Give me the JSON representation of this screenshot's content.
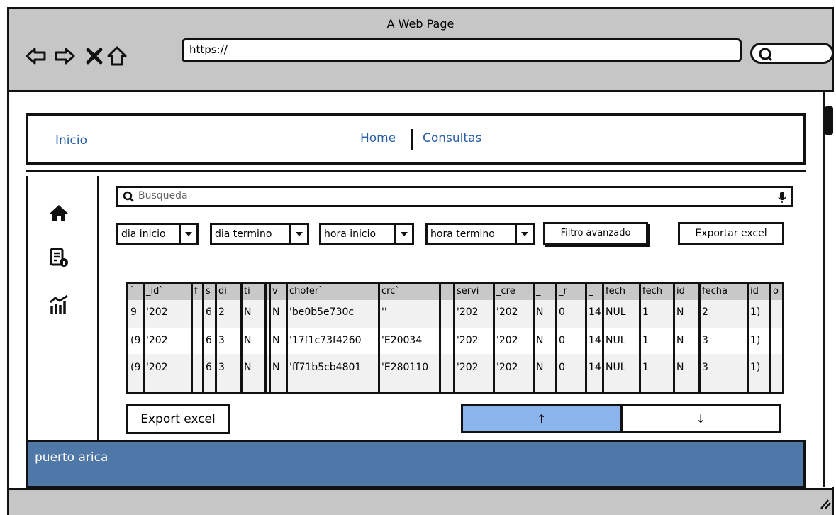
{
  "window": {
    "title": "A Web Page",
    "url": "https://"
  },
  "nav": {
    "left_link": "Inicio",
    "center_links": [
      "Home",
      "Consultas"
    ]
  },
  "search": {
    "placeholder": "Busqueda"
  },
  "filters": {
    "dropdowns": [
      "dia inicio",
      "dia termino",
      "hora inicio",
      "hora termino"
    ],
    "advanced_filter": "Filtro avanzado",
    "export_excel": "Exportar excel"
  },
  "table": {
    "headers": [
      "`",
      "_id`",
      "f",
      "s",
      "di",
      "ti",
      "",
      "v",
      "chofer`",
      "crc`",
      "",
      "servi",
      "_cre",
      "_",
      "_r",
      "_",
      "fech",
      "fech",
      "id",
      "fecha",
      "id",
      "o"
    ],
    "rows": [
      [
        "9",
        "'202",
        "",
        "6",
        "2",
        "N",
        "",
        "N",
        "'be0b5e730c",
        "''",
        "",
        "'202",
        "'202",
        "N",
        "0",
        "14",
        "NUL",
        "1",
        "N",
        "2",
        "1)",
        ""
      ],
      [
        "(9",
        "'202",
        "",
        "6",
        "3",
        "N",
        "",
        "N",
        "'17f1c73f4260",
        "'E20034",
        "",
        "'202",
        "'202",
        "N",
        "0",
        "14",
        "NUL",
        "1",
        "N",
        "3",
        "1)",
        ""
      ],
      [
        "(9",
        "'202",
        "",
        "6",
        "3",
        "N",
        "",
        "N",
        "'ff71b5cb4801",
        "'E280110",
        "",
        "'202",
        "'202",
        "N",
        "0",
        "14",
        "NUL",
        "1",
        "N",
        "3",
        "1)",
        ""
      ]
    ]
  },
  "actions": {
    "export_button": "Export excel",
    "up_arrow": "↑",
    "down_arrow": "↓"
  },
  "footer": {
    "text": "puerto arica"
  },
  "colors": {
    "chrome": "#c6c6c6",
    "footer": "#4f78a8",
    "pager_active": "#8cb4ec",
    "link": "#2a5fa8"
  },
  "icons": [
    "back-arrow-icon",
    "forward-arrow-icon",
    "close-icon",
    "home-icon",
    "search-icon",
    "report-icon",
    "analytics-icon",
    "microphone-icon"
  ]
}
